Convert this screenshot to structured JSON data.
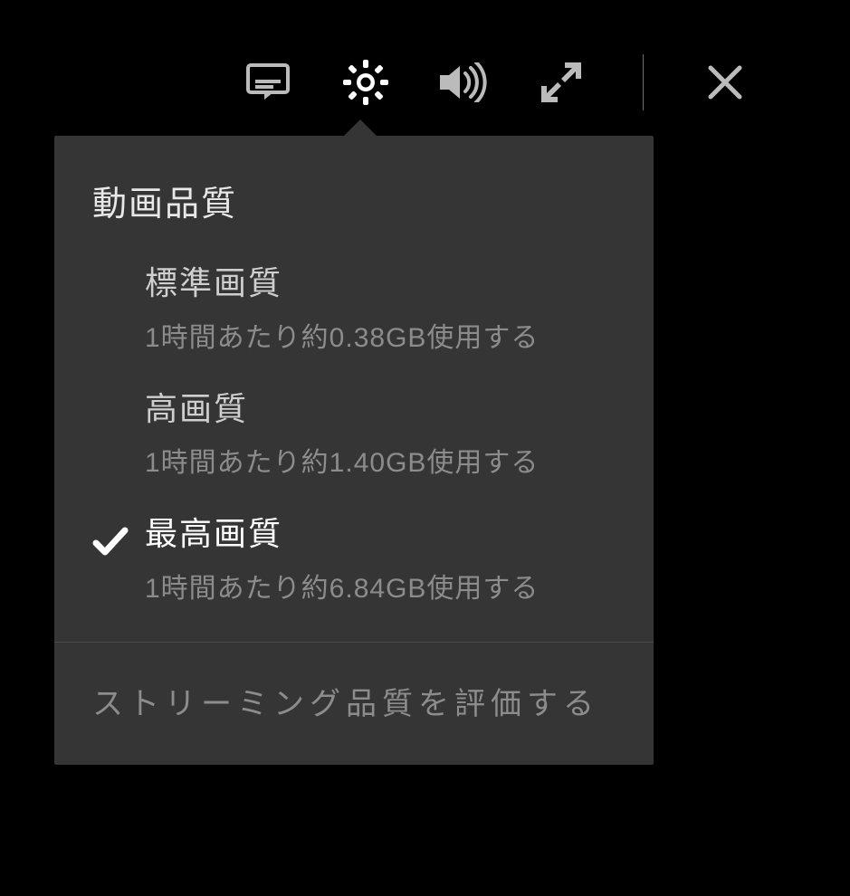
{
  "toolbar": {
    "subtitle_icon": "subtitle-icon",
    "settings_icon": "gear-icon",
    "volume_icon": "volume-icon",
    "fullscreen_icon": "fullscreen-icon",
    "close_icon": "close-icon"
  },
  "popover": {
    "heading": "動画品質",
    "options": [
      {
        "title": "標準画質",
        "desc": "1時間あたり約0.38GB使用する",
        "selected": false
      },
      {
        "title": "高画質",
        "desc": "1時間あたり約1.40GB使用する",
        "selected": false
      },
      {
        "title": "最高画質",
        "desc": "1時間あたり約6.84GB使用する",
        "selected": true
      }
    ],
    "rate_label": "ストリーミング品質を評価する"
  }
}
